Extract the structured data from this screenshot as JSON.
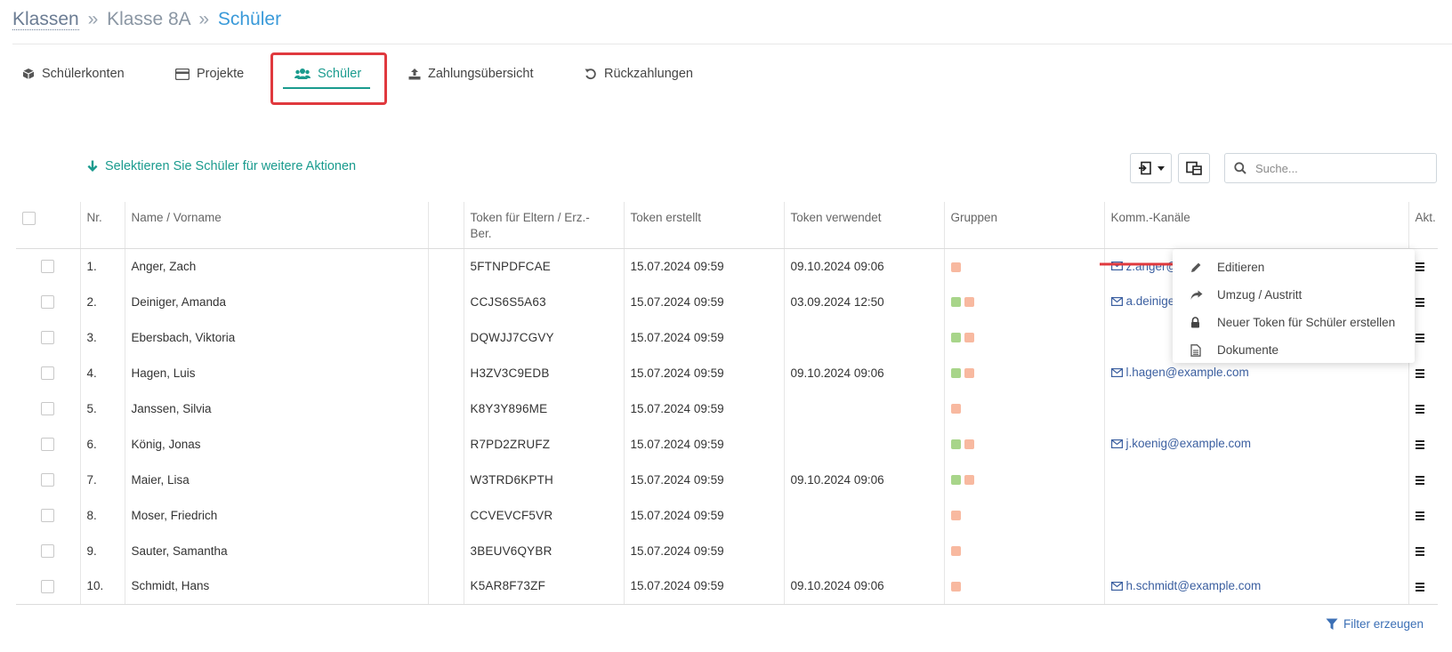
{
  "breadcrumb": {
    "root": "Klassen",
    "sep1": "»",
    "class": "Klasse 8A",
    "sep2": "»",
    "current": "Schüler"
  },
  "tabs": [
    {
      "label": "Schülerkonten",
      "icon": "cube-icon"
    },
    {
      "label": "Projekte",
      "icon": "card-icon"
    },
    {
      "label": "Schüler",
      "icon": "users-icon",
      "active": true
    },
    {
      "label": "Zahlungsübersicht",
      "icon": "upload-icon"
    },
    {
      "label": "Rückzahlungen",
      "icon": "undo-icon"
    }
  ],
  "toolbar": {
    "select_hint": "Selektieren Sie Schüler für weitere Aktionen",
    "search_placeholder": "Suche..."
  },
  "table": {
    "headers": {
      "nr": "Nr.",
      "name": "Name / Vorname",
      "token_line1": "Token für Eltern / Erz.-",
      "token_line2": "Ber.",
      "created": "Token erstellt",
      "used": "Token verwendet",
      "groups": "Gruppen",
      "channels": "Komm.-Kanäle",
      "actions": "Akt."
    },
    "rows": [
      {
        "nr": "1.",
        "name": "Anger, Zach",
        "token": "5FTNPDFCAE",
        "created": "15.07.2024 09:59",
        "used": "09.10.2024 09:06",
        "groups": [
          "orange"
        ],
        "email": "z.anger@"
      },
      {
        "nr": "2.",
        "name": "Deiniger, Amanda",
        "token": "CCJS6S5A63",
        "created": "15.07.2024 09:59",
        "used": "03.09.2024 12:50",
        "groups": [
          "green",
          "orange"
        ],
        "email": "a.deiniger@"
      },
      {
        "nr": "3.",
        "name": "Ebersbach, Viktoria",
        "token": "DQWJJ7CGVY",
        "created": "15.07.2024 09:59",
        "used": "",
        "groups": [
          "green",
          "orange"
        ],
        "email": ""
      },
      {
        "nr": "4.",
        "name": "Hagen, Luis",
        "token": "H3ZV3C9EDB",
        "created": "15.07.2024 09:59",
        "used": "09.10.2024 09:06",
        "groups": [
          "green",
          "orange"
        ],
        "email": "l.hagen@example.com"
      },
      {
        "nr": "5.",
        "name": "Janssen, Silvia",
        "token": "K8Y3Y896ME",
        "created": "15.07.2024 09:59",
        "used": "",
        "groups": [
          "orange"
        ],
        "email": ""
      },
      {
        "nr": "6.",
        "name": "König, Jonas",
        "token": "R7PD2ZRUFZ",
        "created": "15.07.2024 09:59",
        "used": "",
        "groups": [
          "green",
          "orange"
        ],
        "email": "j.koenig@example.com"
      },
      {
        "nr": "7.",
        "name": "Maier, Lisa",
        "token": "W3TRD6KPTH",
        "created": "15.07.2024 09:59",
        "used": "09.10.2024 09:06",
        "groups": [
          "green",
          "orange"
        ],
        "email": ""
      },
      {
        "nr": "8.",
        "name": "Moser, Friedrich",
        "token": "CCVEVCF5VR",
        "created": "15.07.2024 09:59",
        "used": "",
        "groups": [
          "orange"
        ],
        "email": ""
      },
      {
        "nr": "9.",
        "name": "Sauter, Samantha",
        "token": "3BEUV6QYBR",
        "created": "15.07.2024 09:59",
        "used": "",
        "groups": [
          "orange"
        ],
        "email": ""
      },
      {
        "nr": "10.",
        "name": "Schmidt, Hans",
        "token": "K5AR8F73ZF",
        "created": "15.07.2024 09:59",
        "used": "09.10.2024 09:06",
        "groups": [
          "orange"
        ],
        "email": "h.schmidt@example.com"
      }
    ]
  },
  "context_menu": {
    "items": [
      {
        "label": "Editieren",
        "icon": "pencil-icon"
      },
      {
        "label": "Umzug / Austritt",
        "icon": "share-icon"
      },
      {
        "label": "Neuer Token für Schüler erstellen",
        "icon": "lock-icon"
      },
      {
        "label": "Dokumente",
        "icon": "document-icon"
      }
    ]
  },
  "footer": {
    "filter_label": "Filter erzeugen"
  },
  "colors": {
    "accent": "#1a9b8e",
    "link": "#3b6fb5",
    "highlight": "#e0393e",
    "group_green": "#a8d58a",
    "group_orange": "#f8b9a0"
  }
}
